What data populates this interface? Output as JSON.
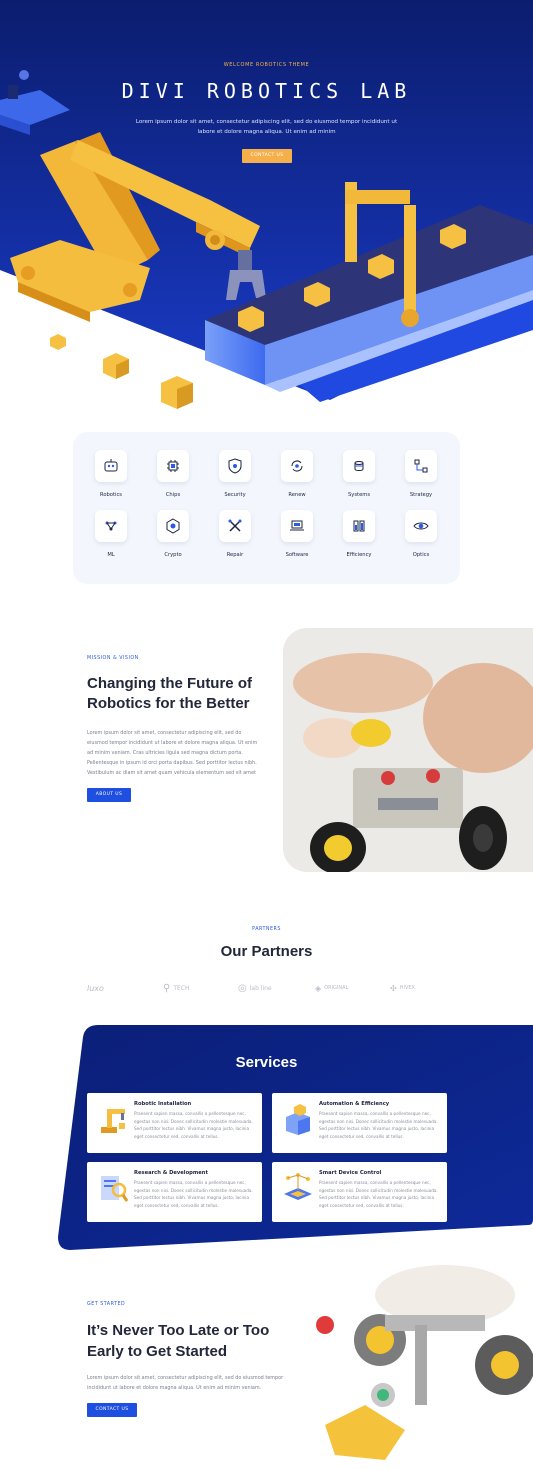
{
  "hero": {
    "eyebrow": "WELCOME ROBOTICS THEME",
    "title": "DIVI ROBOTICS LAB",
    "text": "Lorem ipsum dolor sit amet, consectetur adipiscing elit, sed do eiusmod tempor incididunt ut labore et dolore magna aliqua. Ut enim ad minim",
    "button": "CONTACT US"
  },
  "icons": {
    "row1": [
      {
        "label": "Robotics",
        "icon": "robot-icon"
      },
      {
        "label": "Chips",
        "icon": "chip-icon"
      },
      {
        "label": "Security",
        "icon": "shield-icon"
      },
      {
        "label": "Renew",
        "icon": "renew-icon"
      },
      {
        "label": "Systems",
        "icon": "systems-icon"
      },
      {
        "label": "Strategy",
        "icon": "strategy-icon"
      }
    ],
    "row2": [
      {
        "label": "ML",
        "icon": "network-icon"
      },
      {
        "label": "Crypto",
        "icon": "crypto-icon"
      },
      {
        "label": "Repair",
        "icon": "tools-icon"
      },
      {
        "label": "Software",
        "icon": "laptop-icon"
      },
      {
        "label": "Efficiency",
        "icon": "battery-icon"
      },
      {
        "label": "Optics",
        "icon": "eye-icon"
      }
    ]
  },
  "mission": {
    "eyebrow": "MISSION & VISION",
    "title": "Changing the Future of Robotics for the Better",
    "text": "Lorem ipsum dolor sit amet, consectetur adipiscing elit, sed do eiusmod tempor incididunt ut labore et dolore magna aliqua. Ut enim ad minim veniam. Cras ultricies ligula sed magna dictum porta. Pellentesque in ipsum id orci porta dapibus. Sed porttitor lectus nibh. Vestibulum ac diam sit amet quam vehicula elementum sed sit amet",
    "button": "ABOUT US"
  },
  "partners": {
    "eyebrow": "PARTNERS",
    "title": "Our Partners",
    "logos": [
      "luxo",
      "TECH",
      "lab line",
      "ORIGINAL",
      "HIVEX"
    ]
  },
  "services": {
    "title": "Services",
    "cards": [
      {
        "title": "Robotic Installation",
        "text": "Praesent sapien massa, convallis a pellentesque nec, egestas non nisi. Donec sollicitudin molestie malesuada. Sed porttitor lectus nibh. Vivamus magna justo, lacinia eget consectetur sed, convallis at tellus.",
        "icon": "robot-arm-icon"
      },
      {
        "title": "Automation & Efficiency",
        "text": "Praesent sapien massa, convallis a pellentesque nec, egestas non nisi. Donec sollicitudin molestie malesuada. Sed porttitor lectus nibh. Vivamus magna justo, lacinia eget consectetur sed, convallis at tellus.",
        "icon": "box-icon"
      },
      {
        "title": "Research & Development",
        "text": "Praesent sapien massa, convallis a pellentesque nec, egestas non nisi. Donec sollicitudin molestie malesuada. Sed porttitor lectus nibh. Vivamus magna justo, lacinia eget consectetur sed, convallis at tellus.",
        "icon": "research-icon"
      },
      {
        "title": "Smart Device Control",
        "text": "Praesent sapien massa, convallis a pellentesque nec, egestas non nisi. Donec sollicitudin molestie malesuada. Sed porttitor lectus nibh. Vivamus magna justo, lacinia eget consectetur sed, convallis at tellus.",
        "icon": "smart-device-icon"
      }
    ]
  },
  "get_started": {
    "eyebrow": "GET STARTED",
    "title": "It’s Never Too Late or Too Early to Get Started",
    "text": "Lorem ipsum dolor sit amet, consectetur adipiscing elit, sed do eiusmod tempor incididunt ut labore et dolore magna aliqua. Ut enim ad minim veniam.",
    "button": "CONTACT US"
  },
  "colors": {
    "navy": "#0a1f7a",
    "blue": "#1f4fe0",
    "accent": "#f5b04c",
    "panel": "#f3f7fd"
  }
}
